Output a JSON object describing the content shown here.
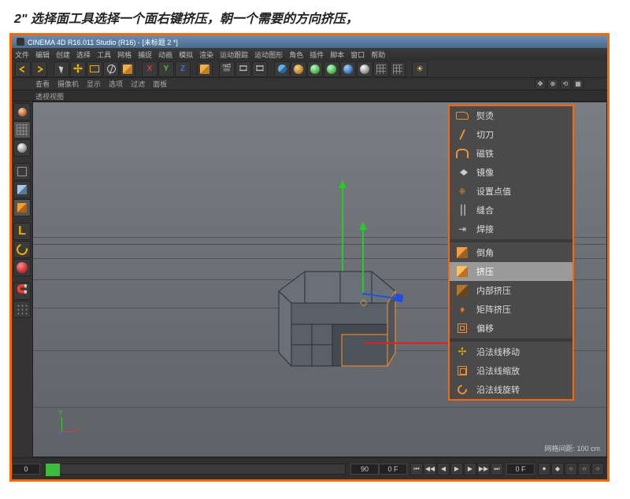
{
  "caption": "2\" 选择面工具选择一个面右键挤压，朝一个需要的方向挤压，",
  "title": "CINEMA 4D R16.011 Studio (R16) - [未标题 2 *]",
  "menu": [
    "文件",
    "编辑",
    "创建",
    "选择",
    "工具",
    "网格",
    "捕捉",
    "动画",
    "模拟",
    "渲染",
    "运动跟踪",
    "运动图形",
    "角色",
    "插件",
    "脚本",
    "窗口",
    "帮助"
  ],
  "viewbar": [
    "查看",
    "摄像机",
    "显示",
    "选项",
    "过滤",
    "面板"
  ],
  "viewtab": "透视视图",
  "axis": {
    "x": "X",
    "y": "Y",
    "z": "Z"
  },
  "context": {
    "items": [
      {
        "icon": "iron",
        "label": "熨烫"
      },
      {
        "icon": "knife",
        "label": "切刀"
      },
      {
        "icon": "magnet",
        "label": "磁铁"
      },
      {
        "icon": "mirror",
        "label": "镜像"
      },
      {
        "icon": "setpt",
        "label": "设置点值"
      },
      {
        "icon": "stitch",
        "label": "缝合"
      },
      {
        "icon": "weld",
        "label": "焊接"
      }
    ],
    "items2": [
      {
        "icon": "bevel",
        "label": "倒角"
      },
      {
        "icon": "extrude",
        "label": "挤压",
        "selected": true
      },
      {
        "icon": "inner",
        "label": "内部挤压"
      },
      {
        "icon": "matrix",
        "label": "矩阵挤压"
      },
      {
        "icon": "offset",
        "label": "偏移"
      }
    ],
    "items3": [
      {
        "icon": "nmove",
        "label": "沿法线移动"
      },
      {
        "icon": "nscale",
        "label": "沿法线缩放"
      },
      {
        "icon": "nrot",
        "label": "沿法线旋转"
      }
    ]
  },
  "viewport": {
    "status": "网格间距: 100 cm",
    "gizmo": {
      "x": "X",
      "y": "Y"
    }
  },
  "timeline": {
    "start": "0",
    "end": "90",
    "cur": "0 F",
    "cur2": "0 F"
  }
}
